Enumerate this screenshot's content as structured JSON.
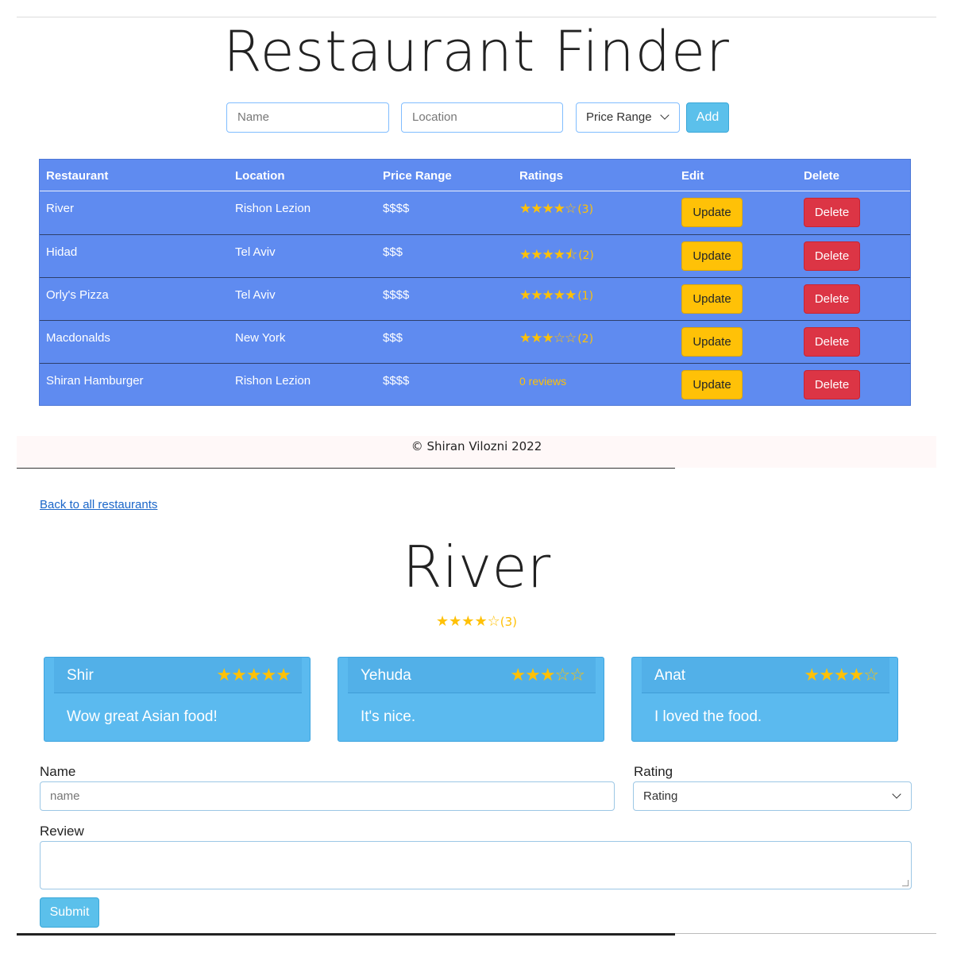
{
  "app": {
    "title": "Restaurant Finder"
  },
  "add_form": {
    "name_placeholder": "Name",
    "location_placeholder": "Location",
    "price_select": "Price Range",
    "add_label": "Add"
  },
  "table": {
    "headers": [
      "Restaurant",
      "Location",
      "Price Range",
      "Ratings",
      "Edit",
      "Delete"
    ],
    "rows": [
      {
        "name": "River",
        "location": "Rishon Lezion",
        "price": "$$$$",
        "stars": "★★★★☆",
        "count": "(3)",
        "update": "Update",
        "delete": "Delete"
      },
      {
        "name": "Hidad",
        "location": "Tel Aviv",
        "price": "$$$",
        "stars": "★★★★⯪",
        "count": "(2)",
        "update": "Update",
        "delete": "Delete"
      },
      {
        "name": "Orly's Pizza",
        "location": "Tel Aviv",
        "price": "$$$$",
        "stars": "★★★★★",
        "count": "(1)",
        "update": "Update",
        "delete": "Delete"
      },
      {
        "name": "Macdonalds",
        "location": "New York",
        "price": "$$$",
        "stars": "★★★☆☆",
        "count": "(2)",
        "update": "Update",
        "delete": "Delete"
      },
      {
        "name": "Shiran Hamburger",
        "location": "Rishon Lezion",
        "price": "$$$$",
        "no_reviews": "0 reviews",
        "update": "Update",
        "delete": "Delete"
      }
    ]
  },
  "footer": {
    "text": "© Shiran Vilozni 2022"
  },
  "detail": {
    "back_link": "Back to all restaurants",
    "title": "River",
    "stars": "★★★★☆",
    "count": "(3)",
    "reviews": [
      {
        "name": "Shir",
        "stars": "★★★★★",
        "text": "Wow great Asian food!"
      },
      {
        "name": "Yehuda",
        "stars": "★★★☆☆",
        "text": "It's nice."
      },
      {
        "name": "Anat",
        "stars": "★★★★☆",
        "text": "I loved the food."
      }
    ],
    "form": {
      "name_label": "Name",
      "name_placeholder": "name",
      "rating_label": "Rating",
      "rating_select": "Rating",
      "review_label": "Review",
      "submit_label": "Submit"
    }
  },
  "colors": {
    "table_bg": "#5f8bf0",
    "accent": "#5bc0eb",
    "star": "#ffc107",
    "update": "#ffc107",
    "delete": "#dc3545"
  }
}
